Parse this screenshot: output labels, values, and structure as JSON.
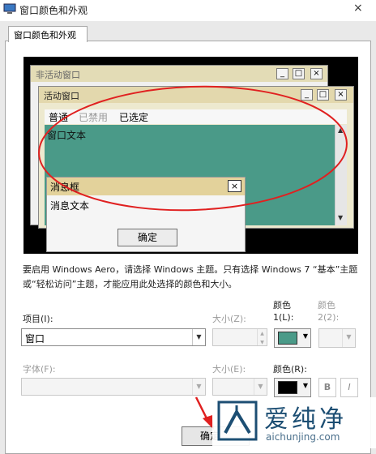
{
  "window": {
    "title": "窗口颜色和外观",
    "close_glyph": "×"
  },
  "tab": {
    "label": "窗口颜色和外观"
  },
  "preview": {
    "inactive_title": "非活动窗口",
    "active_title": "活动窗口",
    "controls": {
      "min": "_",
      "max": "□",
      "close": "×"
    },
    "menu": {
      "normal": "普通",
      "disabled": "已禁用",
      "selected": "已选定"
    },
    "window_text": "窗口文本",
    "scroll": {
      "up": "▲",
      "down": "▼"
    },
    "message_box": {
      "title": "消息框",
      "text": "消息文本",
      "ok": "确定",
      "close": "×"
    }
  },
  "description": "要启用 Windows Aero，请选择 Windows 主题。只有选择 Windows 7 “基本”主题或“轻松访问”主题，才能应用此处选择的颜色和大小。",
  "form": {
    "item_label": "项目(I):",
    "item_value": "窗口",
    "size1_label": "大小(Z):",
    "color1_label": "颜色",
    "color1_sub": "1(L):",
    "color2_label": "颜色",
    "color2_sub": "2(2):",
    "font_label": "字体(F):",
    "size2_label": "大小(E):",
    "color_r_label": "颜色(R):",
    "bold": "B",
    "italic": "I",
    "dropdown_arrow": "▼",
    "spin_up": "▲",
    "spin_down": "▼"
  },
  "colors": {
    "item_color1": "#4a9a88",
    "font_color": "#000000",
    "annotation": "#e02020"
  },
  "buttons": {
    "confirm": "确定"
  },
  "watermark": {
    "name": "爱纯净",
    "url": "aichunjing.com"
  }
}
